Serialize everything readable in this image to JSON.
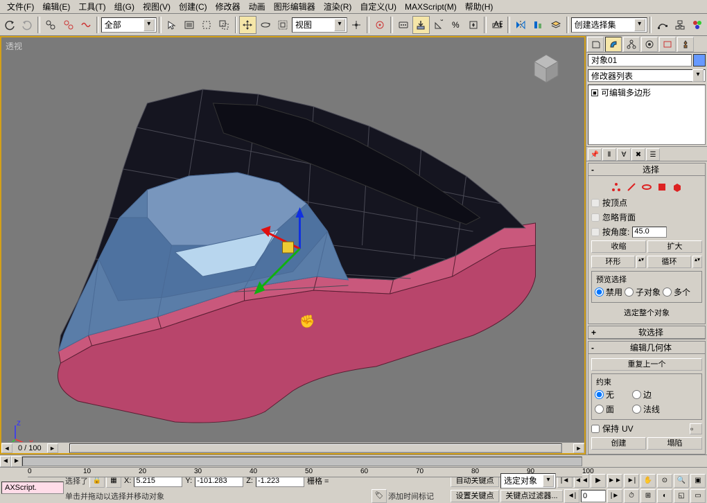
{
  "menu": {
    "file": "文件(F)",
    "edit": "编辑(E)",
    "tools": "工具(T)",
    "group": "组(G)",
    "views": "视图(V)",
    "create": "创建(C)",
    "modifiers": "修改器",
    "animation": "动画",
    "graph": "图形编辑器",
    "rendering": "渲染(R)",
    "customize": "自定义(U)",
    "maxscript": "MAXScript(M)",
    "help": "帮助(H)"
  },
  "toolbar": {
    "all_filter": "全部",
    "coord_system": "视图",
    "selection_set": "创建选择集"
  },
  "viewport": {
    "label": "透视",
    "frame_counter": "0 / 100"
  },
  "sidepanel": {
    "object_name": "对象01",
    "modifier_list": "修改器列表",
    "modifier_item": "可编辑多边形",
    "rollouts": {
      "selection": {
        "title": "选择",
        "by_vertex": "按顶点",
        "ignore_backfacing": "忽略背面",
        "by_angle": "按角度:",
        "angle_value": "45.0",
        "shrink": "收缩",
        "grow": "扩大",
        "ring": "环形",
        "loop": "循环",
        "preview_label": "预览选择",
        "disable": "禁用",
        "subobj": "子对象",
        "multi": "多个",
        "selected_info": "选定整个对象"
      },
      "soft_selection": {
        "title": "软选择"
      },
      "edit_geometry": {
        "title": "编辑几何体",
        "repeat_last": "重复上一个",
        "constraints": "约束",
        "none": "无",
        "edge": "边",
        "face": "面",
        "normal": "法线",
        "preserve_uv": "保持",
        "uv": "UV",
        "create": "创建",
        "collapse": "塌陷"
      }
    }
  },
  "timeline": {
    "ticks": [
      "0",
      "10",
      "20",
      "30",
      "40",
      "50",
      "60",
      "70",
      "80",
      "90",
      "100"
    ],
    "selected_label": "选择了",
    "x": "5.215",
    "y": "-101.283",
    "z": "-1.223",
    "grid": "栅格 =",
    "add_time_tag": "添加时间标记",
    "auto_key": "自动关键点",
    "selected_obj": "选定对象",
    "set_key": "设置关键点",
    "key_filters": "关键点过滤器...",
    "maxscript_label": "AXScript.",
    "prompt": "单击并拖动以选择并移动对象"
  }
}
